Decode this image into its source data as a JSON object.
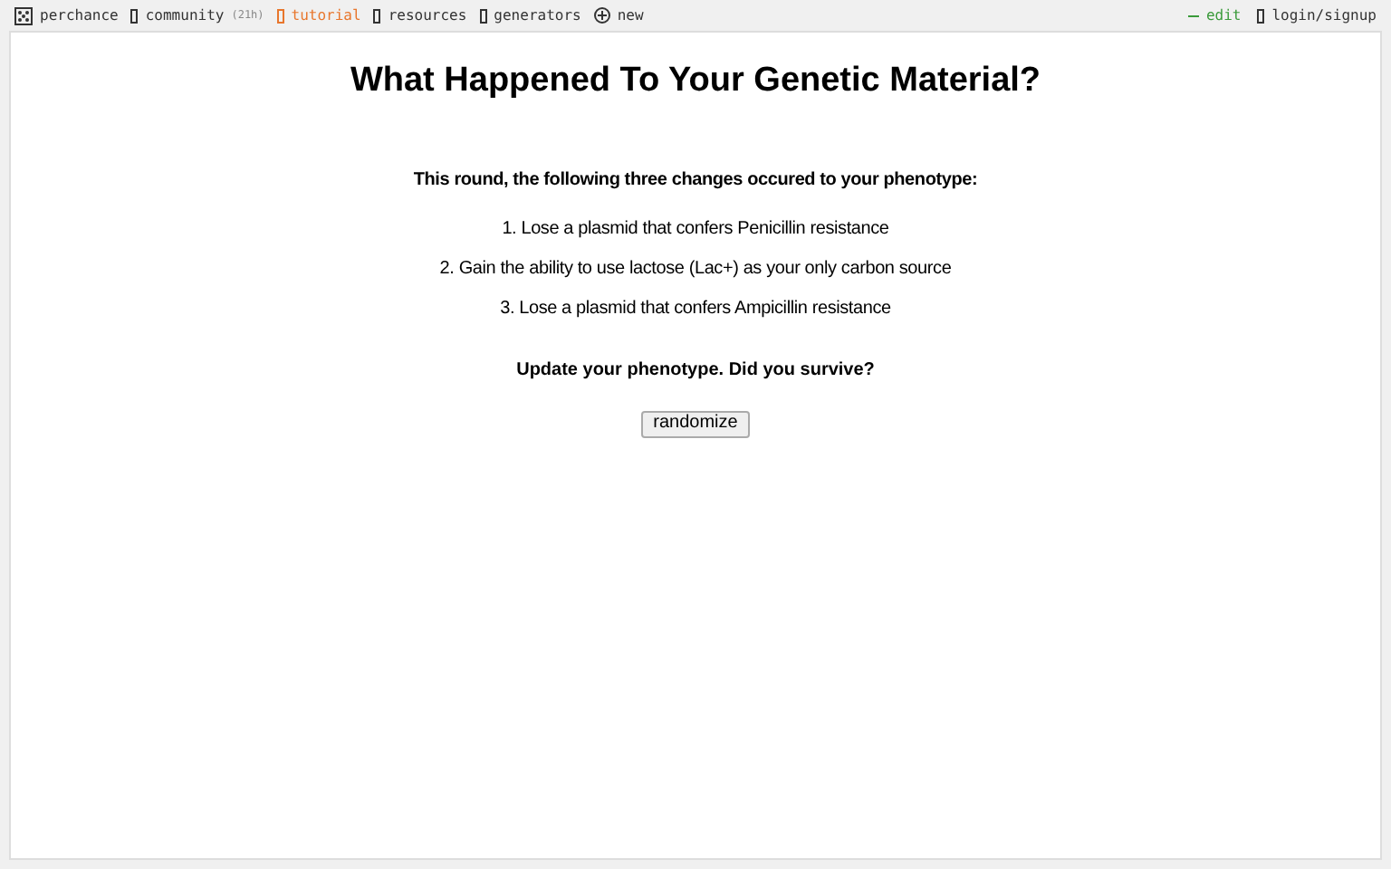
{
  "nav": [
    {
      "label": "perchance",
      "kind": "logo",
      "selected": false
    },
    {
      "label": "community",
      "kind": "box",
      "badge": "(21h)",
      "selected": false
    },
    {
      "label": "tutorial",
      "kind": "box",
      "selected": true
    },
    {
      "label": "resources",
      "kind": "box",
      "selected": false
    },
    {
      "label": "generators",
      "kind": "box",
      "selected": false
    },
    {
      "label": "new",
      "kind": "plus",
      "selected": false
    }
  ],
  "edit": "edit",
  "login": "login/signup",
  "title": "What Happened To Your Genetic Material?",
  "intro": "This round, the following three changes occured to your phenotype:",
  "changes": [
    "1. Lose a plasmid that confers Penicillin resistance",
    "2. Gain the ability to use lactose (Lac+) as your only carbon source",
    "3. Lose a plasmid that confers Ampicillin resistance"
  ],
  "question": "Update your phenotype. Did you survive?",
  "button": "randomize"
}
